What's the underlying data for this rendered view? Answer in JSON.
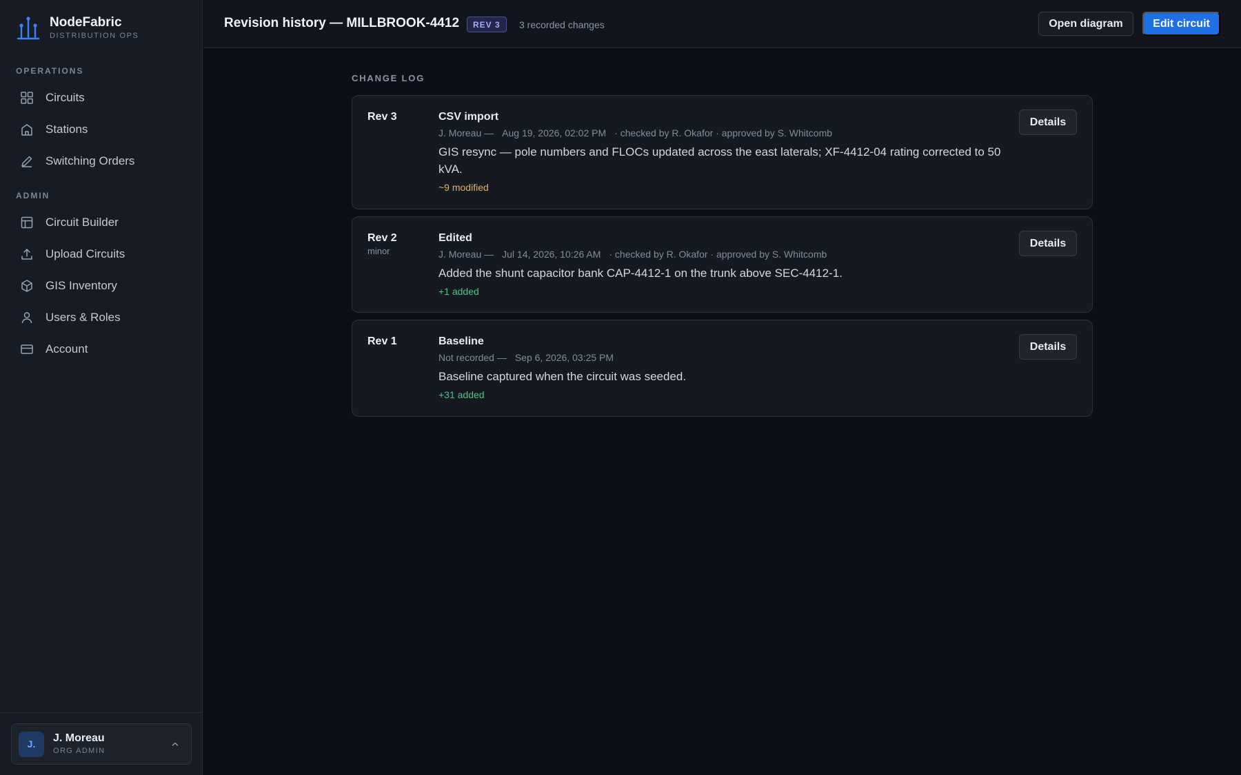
{
  "brand": {
    "name": "NodeFabric",
    "subtitle": "DISTRIBUTION OPS",
    "accent": "#3b82f6"
  },
  "sidebar": {
    "sections": [
      {
        "label": "OPERATIONS",
        "items": [
          {
            "label": "Circuits",
            "icon": "grid-icon"
          },
          {
            "label": "Stations",
            "icon": "station-icon"
          },
          {
            "label": "Switching Orders",
            "icon": "pencil-icon"
          }
        ]
      },
      {
        "label": "ADMIN",
        "items": [
          {
            "label": "Circuit Builder",
            "icon": "layout-icon"
          },
          {
            "label": "Upload Circuits",
            "icon": "upload-icon"
          },
          {
            "label": "GIS Inventory",
            "icon": "cube-icon"
          },
          {
            "label": "Users & Roles",
            "icon": "user-icon"
          },
          {
            "label": "Account",
            "icon": "card-icon"
          }
        ]
      }
    ],
    "user": {
      "initials": "J.",
      "name": "J. Moreau",
      "role": "ORG ADMIN"
    }
  },
  "header": {
    "title": "Revision history — MILLBROOK-4412",
    "badge": "REV 3",
    "count": "3 recorded changes",
    "open_diagram": "Open diagram",
    "edit_circuit": "Edit circuit"
  },
  "changelog": {
    "label": "CHANGE LOG",
    "details_label": "Details",
    "revisions": [
      {
        "rev": "Rev 3",
        "tag": "",
        "title": "CSV import",
        "author": "J. Moreau —",
        "date": "Aug 19, 2026, 02:02 PM",
        "review": "· checked by R. Okafor · approved by S. Whitcomb",
        "description": "GIS resync — pole numbers and FLOCs updated across the east laterals; XF-4412-04 rating corrected to 50 kVA.",
        "delta": "~9 modified",
        "delta_kind": "modified"
      },
      {
        "rev": "Rev 2",
        "tag": "minor",
        "title": "Edited",
        "author": "J. Moreau —",
        "date": "Jul 14, 2026, 10:26 AM",
        "review": "· checked by R. Okafor · approved by S. Whitcomb",
        "description": "Added the shunt capacitor bank CAP-4412-1 on the trunk above SEC-4412-1.",
        "delta": "+1 added",
        "delta_kind": "added"
      },
      {
        "rev": "Rev 1",
        "tag": "",
        "title": "Baseline",
        "author": "Not recorded —",
        "date": "Sep 6, 2026, 03:25 PM",
        "review": "",
        "description": "Baseline captured when the circuit was seeded.",
        "delta": "+31 added",
        "delta_kind": "added"
      }
    ]
  }
}
